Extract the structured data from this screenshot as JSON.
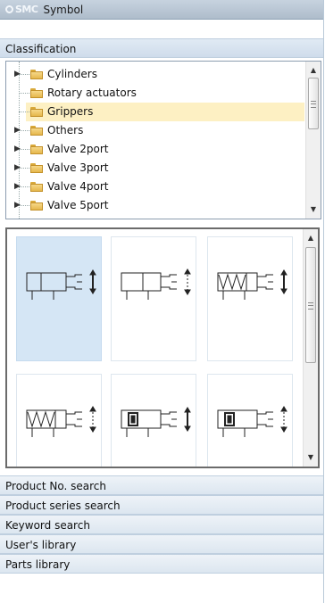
{
  "app": {
    "brand": "SMC",
    "title": "Symbol"
  },
  "sections": {
    "classification": "Classification",
    "product_no_search": "Product No. search",
    "product_series_search": "Product series search",
    "keyword_search": "Keyword search",
    "users_library": "User's library",
    "parts_library": "Parts library"
  },
  "tree": {
    "items": [
      {
        "label": "Cylinders",
        "expandable": true,
        "selected": false
      },
      {
        "label": "Rotary actuators",
        "expandable": false,
        "selected": false
      },
      {
        "label": "Grippers",
        "expandable": false,
        "selected": true
      },
      {
        "label": "Others",
        "expandable": true,
        "selected": false
      },
      {
        "label": "Valve 2port",
        "expandable": true,
        "selected": false
      },
      {
        "label": "Valve 3port",
        "expandable": true,
        "selected": false
      },
      {
        "label": "Valve 4port",
        "expandable": true,
        "selected": false
      },
      {
        "label": "Valve 5port",
        "expandable": true,
        "selected": false
      }
    ]
  },
  "symbols": [
    {
      "kind": "gripper-basic",
      "selected": true
    },
    {
      "kind": "gripper-double",
      "selected": false
    },
    {
      "kind": "gripper-spring",
      "selected": false
    },
    {
      "kind": "gripper-spring-double",
      "selected": false
    },
    {
      "kind": "gripper-magnet",
      "selected": false
    },
    {
      "kind": "gripper-magnet-double",
      "selected": false
    }
  ],
  "colors": {
    "selected_tree": "#fdf0c3",
    "selected_tile": "#d5e6f5",
    "header": "#dce6f0",
    "folder": "#e5b74c"
  },
  "icons": [
    "smc-logo-icon",
    "folder-icon",
    "expand-arrow-icon",
    "scroll-up-arrow-icon",
    "scroll-down-arrow-icon"
  ]
}
